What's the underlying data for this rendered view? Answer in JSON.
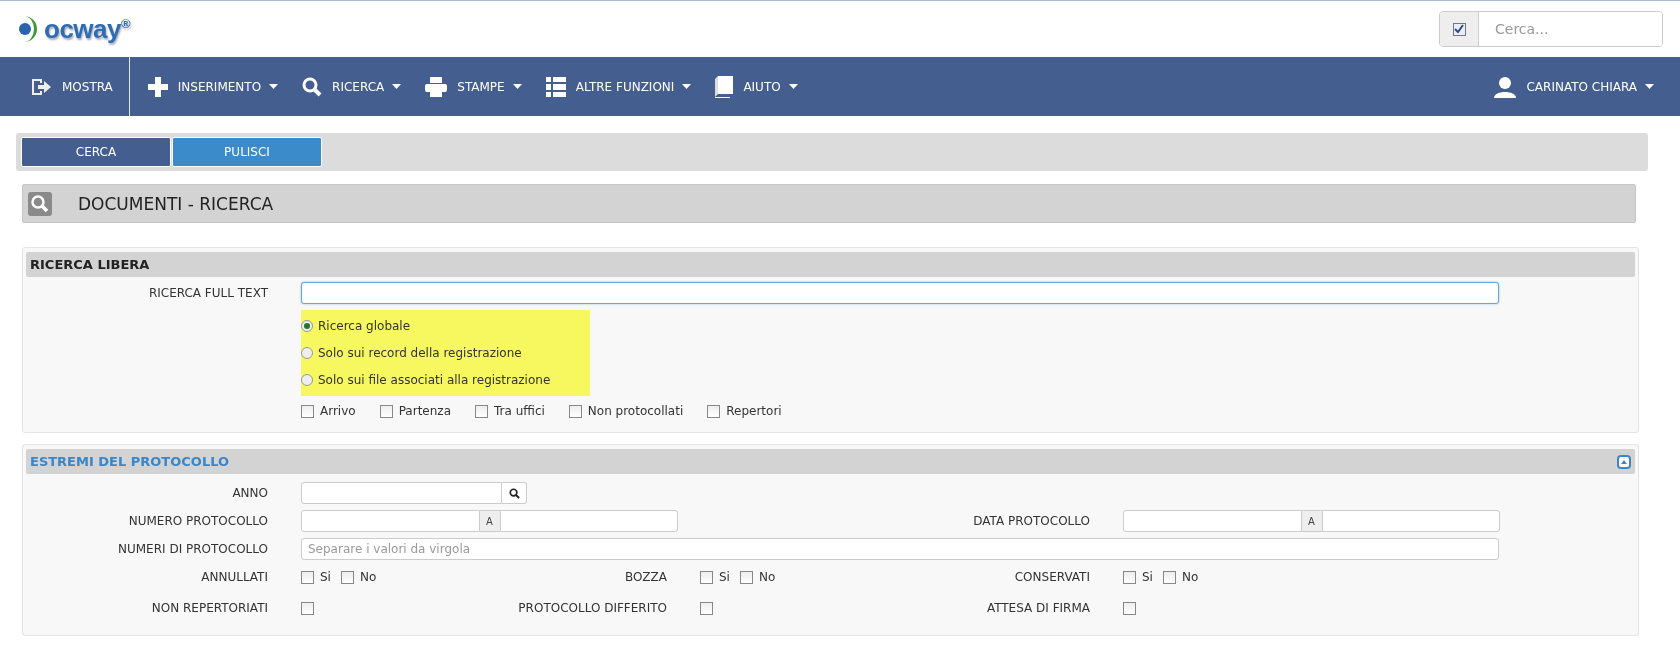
{
  "logo": {
    "text": "ocway$^{®}$"
  },
  "header_search": {
    "checked": true,
    "placeholder": "Cerca..."
  },
  "nav": {
    "items": [
      {
        "label": "MOSTRA",
        "dropdown": false
      },
      {
        "label": "INSERIMENTO",
        "dropdown": true
      },
      {
        "label": "RICERCA",
        "dropdown": true
      },
      {
        "label": "STAMPE",
        "dropdown": true
      },
      {
        "label": "ALTRE FUNZIONI",
        "dropdown": true
      },
      {
        "label": "AIUTO",
        "dropdown": true
      }
    ],
    "user": {
      "label": "CARINATO CHIARA",
      "dropdown": true
    }
  },
  "toolbar": {
    "buttons": [
      {
        "label": "CERCA",
        "kind": "primary"
      },
      {
        "label": "PULISCI",
        "kind": "secondary"
      }
    ]
  },
  "page_title": "DOCUMENTI - RICERCA",
  "free_search": {
    "title": "RICERCA LIBERA",
    "full_text": {
      "label": "RICERCA FULL TEXT"
    },
    "scope": [
      {
        "label": "Ricerca globale",
        "selected": true
      },
      {
        "label": "Solo sui record della registrazione",
        "selected": false
      },
      {
        "label": "Solo sui file associati alla registrazione",
        "selected": false
      }
    ],
    "types": [
      {
        "label": "Arrivo",
        "checked": false
      },
      {
        "label": "Partenza",
        "checked": false
      },
      {
        "label": "Tra uffici",
        "checked": false
      },
      {
        "label": "Non protocollati",
        "checked": false
      },
      {
        "label": "Repertori",
        "checked": false
      }
    ]
  },
  "protocol": {
    "title": "ESTREMI DEL PROTOCOLLO",
    "expanded": true,
    "rows": [
      {
        "fields": [
          {
            "label": "ANNO",
            "kind": "lookup"
          }
        ]
      },
      {
        "fields": [
          {
            "label": "NUMERO PROTOCOLLO",
            "kind": "range",
            "separator": "A"
          },
          {
            "label": "DATA PROTOCOLLO",
            "kind": "range",
            "separator": "A"
          }
        ]
      },
      {
        "fields": [
          {
            "label": "NUMERI DI PROTOCOLLO",
            "kind": "text",
            "placeholder": "Separare i valori da virgola"
          }
        ]
      },
      {
        "fields": [
          {
            "label": "ANNULLATI",
            "kind": "checks",
            "options": [
              {
                "label": "Si",
                "checked": false
              },
              {
                "label": "No",
                "checked": false
              }
            ]
          },
          {
            "label": "BOZZA",
            "kind": "checks",
            "options": [
              {
                "label": "Si",
                "checked": false
              },
              {
                "label": "No",
                "checked": false
              }
            ]
          },
          {
            "label": "CONSERVATI",
            "kind": "checks",
            "options": [
              {
                "label": "Si",
                "checked": false
              },
              {
                "label": "No",
                "checked": false
              }
            ]
          }
        ]
      },
      {
        "fields": [
          {
            "label": "NON REPERTORIATI",
            "kind": "check",
            "checked": false
          },
          {
            "label": "PROTOCOLLO DIFFERITO",
            "kind": "check",
            "checked": false
          },
          {
            "label": "ATTESA DI FIRMA",
            "kind": "check",
            "checked": false
          }
        ]
      }
    ]
  }
}
